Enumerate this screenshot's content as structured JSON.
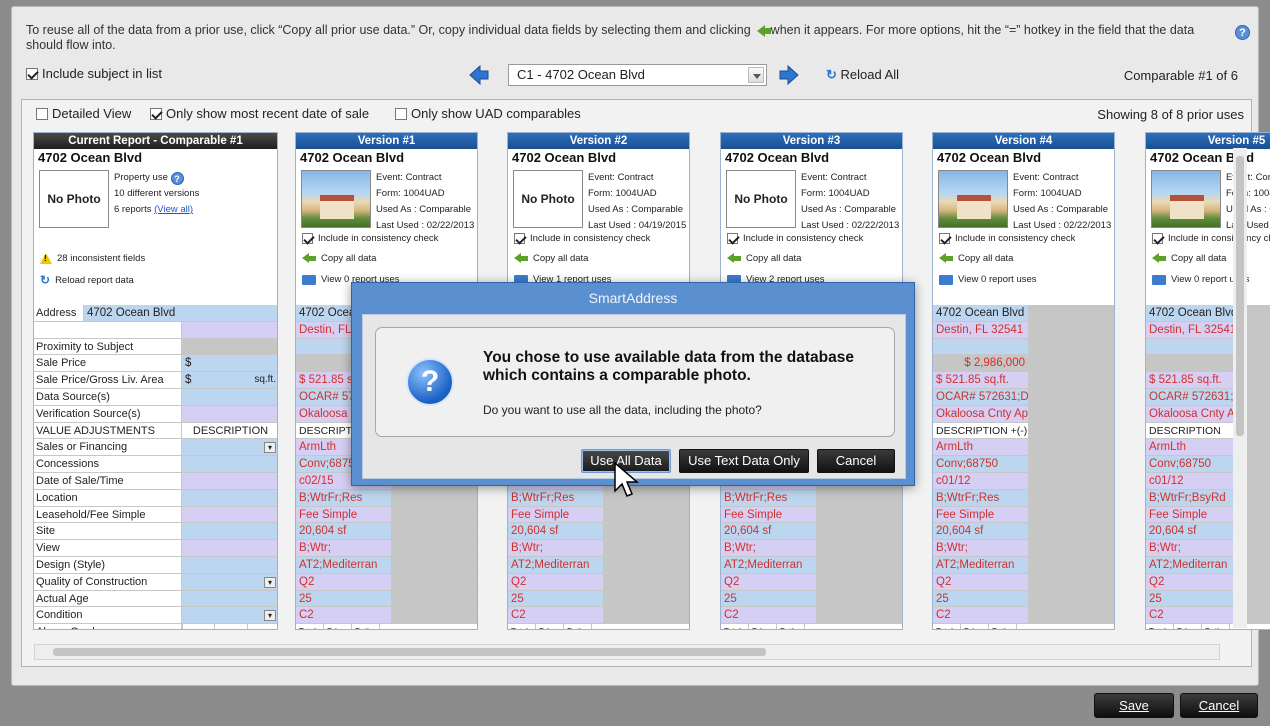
{
  "instructions": {
    "part1": "To reuse all of the data from a prior use, click “Copy all prior use data.”  Or, copy individual data fields by selecting them and clicking",
    "part2": "when it appears.  For more options, hit the “=” hotkey in the field that the data should flow into."
  },
  "toolbar": {
    "include_subject": "Include subject in list",
    "selected_comparable": "C1 - 4702 Ocean Blvd",
    "reload_all": "Reload All",
    "comparable_count": "Comparable #1 of 6"
  },
  "filters": {
    "detailed_view": "Detailed View",
    "most_recent": "Only show most recent date of sale",
    "uad_only": "Only show UAD comparables",
    "showing": "Showing 8 of 8 prior uses"
  },
  "current": {
    "header": "Current Report - Comparable #1",
    "address": "4702 Ocean Blvd",
    "photo": "No Photo",
    "property_use": "Property use",
    "versions": "10 different versions",
    "reports": "6 reports",
    "view_all": "(View all)",
    "inconsistent": "28 inconsistent fields",
    "reload": "Reload report data",
    "labels": [
      "Address",
      "",
      "Proximity to Subject",
      "Sale Price",
      "Sale Price/Gross Liv. Area",
      "Data Source(s)",
      "Verification Source(s)",
      "VALUE ADJUSTMENTS",
      "Sales or Financing",
      "Concessions",
      "Date of Sale/Time",
      "Location",
      "Leasehold/Fee Simple",
      "Site",
      "View",
      "Design (Style)",
      "Quality of Construction",
      "Actual Age",
      "Condition",
      "Above Grade"
    ],
    "address_value": "4702 Ocean Blvd",
    "dollar": "$",
    "sqft": "sq.ft.",
    "description": "DESCRIPTION",
    "grade_cols": [
      "Total",
      "Bdrms.",
      "Baths"
    ]
  },
  "versions": [
    {
      "header": "Version #1",
      "address": "4702 Ocean Blvd",
      "photo": "",
      "event": "Event:  Contract",
      "form": "Form:  1004UAD",
      "used_as": "Used As : Comparable",
      "last_used": "Last Used : 02/22/2013",
      "include": "Include in consistency check",
      "copy": "Copy all data",
      "view": "View 0 report uses",
      "rows": [
        "4702 Ocean Blvd",
        "Destin, FL 32541",
        "",
        "",
        "$  521.85  sq.ft.",
        "OCAR# 572631;DOM 212",
        "Okaloosa Cnty Appraiser Record",
        "DESCRIPTION",
        "ArmLth",
        "Conv;68750",
        "c02/15",
        "B;WtrFr;Res",
        "Fee Simple",
        "20,604 sf",
        "B;Wtr;",
        "AT2;Mediterran",
        "Q2",
        "25",
        "C2",
        ""
      ]
    },
    {
      "header": "Version #2",
      "address": "4702 Ocean Blvd",
      "photo": "No Photo",
      "event": "Event:  Contract",
      "form": "Form:  1004UAD",
      "used_as": "Used As : Comparable",
      "last_used": "Last Used : 04/19/2015",
      "include": "Include in consistency check",
      "copy": "Copy all data",
      "view": "View 1 report uses",
      "rows": [
        "4702 Ocean Blvd",
        "Destin, FL 32541",
        "",
        "",
        "$  521.85  sq.ft.",
        "OCAR# 572631;DOM 212",
        "Okaloosa Cnty Appraiser Record",
        "DESCRIPTION",
        "ArmLth",
        "Conv;68750",
        "c01/12",
        "B;WtrFr;Res",
        "Fee Simple",
        "20,604 sf",
        "B;Wtr;",
        "AT2;Mediterran",
        "Q2",
        "25",
        "C2",
        ""
      ]
    },
    {
      "header": "Version #3",
      "address": "4702 Ocean Blvd",
      "photo": "No Photo",
      "event": "Event:  Contract",
      "form": "Form:  1004UAD",
      "used_as": "Used As : Comparable",
      "last_used": "Last Used : 02/22/2013",
      "include": "Include in consistency check",
      "copy": "Copy all data",
      "view": "View 2 report uses",
      "rows": [
        "4702 Ocean Blvd",
        "Destin, FL 32541",
        "",
        "",
        "$  521.85  sq.ft.",
        "OCAR# 572631;DOM 212",
        "Okaloosa Cnty Appraiser Record",
        "DESCRIPTION",
        "ArmLth",
        "Conv;68750",
        "c01/12",
        "B;WtrFr;Res",
        "Fee Simple",
        "20,604 sf",
        "B;Wtr;",
        "AT2;Mediterran",
        "Q2",
        "25",
        "C2",
        ""
      ]
    },
    {
      "header": "Version #4",
      "address": "4702 Ocean Blvd",
      "photo": "",
      "event": "Event:  Contract",
      "form": "Form:  1004UAD",
      "used_as": "Used As : Comparable",
      "last_used": "Last Used : 02/22/2013",
      "include": "Include in consistency check",
      "copy": "Copy all data",
      "view": "View 0 report uses",
      "rows": [
        "4702 Ocean Blvd",
        "Destin, FL 32541",
        "",
        "$        2,986,000",
        "$  521.85  sq.ft.",
        "OCAR# 572631;DOM 212",
        "Okaloosa Cnty Appraiser Record",
        "DESCRIPTION     +(-) $ Adjustment",
        "ArmLth",
        "Conv;68750",
        "c01/12",
        "B;WtrFr;Res",
        "Fee Simple",
        "20,604 sf",
        "B;Wtr;",
        "AT2;Mediterran",
        "Q2",
        "25",
        "C2",
        ""
      ]
    },
    {
      "header": "Version #5",
      "address": "4702 Ocean Blvd",
      "photo": "",
      "event": "Event:  Contract",
      "form": "Form:  1004UAD",
      "used_as": "Used As : Comparable",
      "last_used": "Last Used : 02/22/2013",
      "include": "Include in consistency check",
      "copy": "Copy all data",
      "view": "View 0 report uses",
      "rows": [
        "4702 Ocean Blvd",
        "Destin, FL 32541",
        "",
        "",
        "$  521.85  sq.ft.",
        "OCAR# 572631;DOM 212",
        "Okaloosa Cnty Appraiser Record",
        "DESCRIPTION",
        "ArmLth",
        "Conv;68750",
        "c01/12",
        "B;WtrFr;BsyRd",
        "Fee Simple",
        "20,604 sf",
        "B;Wtr;",
        "AT2;Mediterran",
        "Q2",
        "25",
        "C2",
        ""
      ]
    }
  ],
  "dialog": {
    "title": "SmartAddress",
    "main": "You chose to use available data from the database which contains a comparable photo.",
    "sub": "Do you want to use all the data, including the photo?",
    "btn_all": "Use All Data",
    "btn_text": "Use Text Data Only",
    "btn_cancel": "Cancel"
  },
  "footer": {
    "save": "Save",
    "cancel": "Cancel"
  },
  "colors": {
    "accent": "#2d6fbd",
    "dialog": "#5a8fd0",
    "warn": "#f0c400",
    "copy_arrow": "#5da02a",
    "red_text": "#d1302d"
  }
}
